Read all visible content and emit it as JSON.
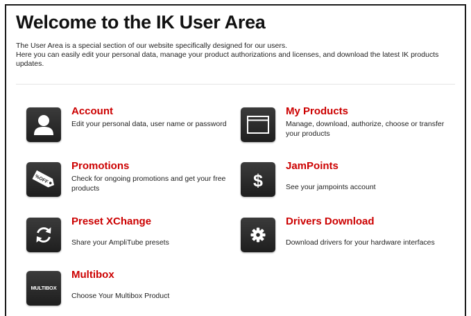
{
  "header": {
    "title": "Welcome to the IK User Area",
    "intro_line1": "The User Area is a special section of our website specifically designed for our users.",
    "intro_line2": "Here you can easily edit your personal data, manage your product authorizations and licenses, and download the latest IK products updates."
  },
  "tiles": {
    "account": {
      "title": "Account",
      "description": "Edit your personal data, user name or password",
      "icon": "user-icon"
    },
    "my_products": {
      "title": "My Products",
      "description": "Manage, download, authorize, choose or transfer your products",
      "icon": "window-icon"
    },
    "promotions": {
      "title": "Promotions",
      "description": "Check for ongoing promotions and get your free products",
      "icon": "price-tag-icon",
      "icon_text": "%OFF"
    },
    "jampoints": {
      "title": "JamPoints",
      "description": "See your jampoints account",
      "icon": "dollar-icon",
      "icon_text": "$"
    },
    "preset_xchange": {
      "title": "Preset XChange",
      "description": "Share your AmpliTube presets",
      "icon": "sync-arrows-icon"
    },
    "drivers_download": {
      "title": "Drivers Download",
      "description": "Download drivers for your hardware interfaces",
      "icon": "gear-icon"
    },
    "multibox": {
      "title": "Multibox",
      "description": "Choose Your Multibox Product",
      "icon": "multibox-logo-icon",
      "icon_text": "MULTIBOX"
    }
  },
  "colors": {
    "accent_red": "#cc0000",
    "icon_background": "#2a2a2a",
    "text": "#222222"
  }
}
